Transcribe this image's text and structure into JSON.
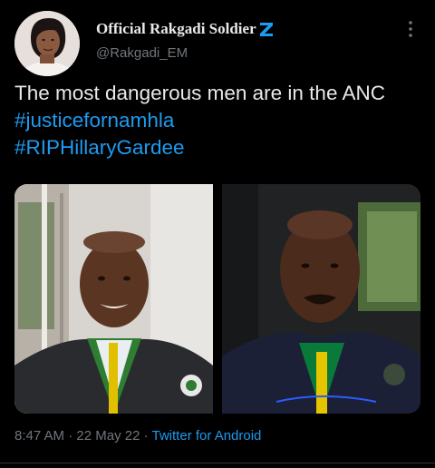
{
  "author": {
    "display_name": "Official Rakgadi Soldier",
    "handle": "@Rakgadi_EM",
    "badge_icon": "z-badge-icon",
    "more_icon": "more-vertical-icon"
  },
  "tweet": {
    "text_plain": "The most dangerous men are in the ANC",
    "hashtags": [
      "#justicefornamhla",
      "#RIPHillaryGardee"
    ]
  },
  "meta": {
    "time": "8:47 AM",
    "separator": "·",
    "date": "22 May 22",
    "source": "Twitter for Android"
  },
  "colors": {
    "background": "#000000",
    "text": "#e7e9ea",
    "secondary": "#71767b",
    "accent": "#1d9bf0"
  }
}
